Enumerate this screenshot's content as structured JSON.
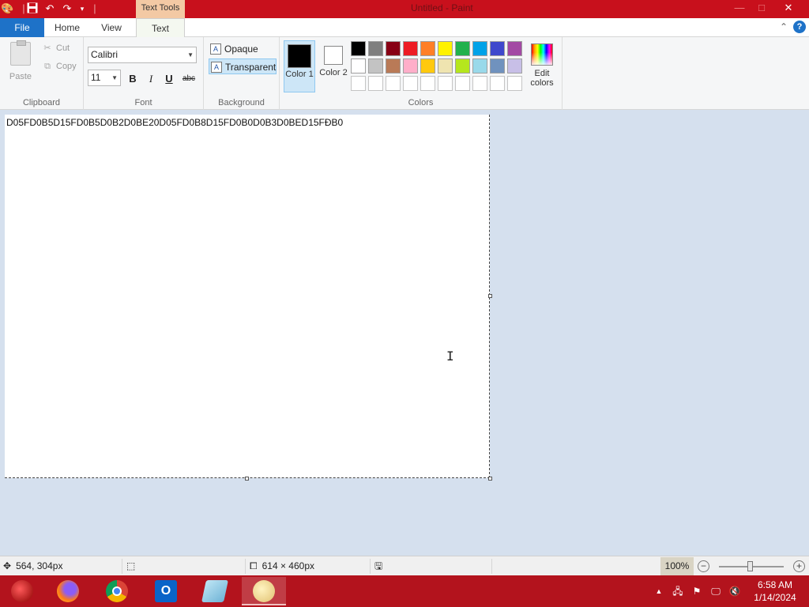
{
  "titlebar": {
    "contextual_tab": "Text Tools",
    "window_title": "Untitled - Paint",
    "minimize": "—",
    "maximize": "□",
    "close": "✕"
  },
  "tabs": {
    "file": "File",
    "home": "Home",
    "view": "View",
    "text": "Text"
  },
  "clipboard": {
    "group_label": "Clipboard",
    "paste": "Paste",
    "cut": "Cut",
    "copy": "Copy"
  },
  "font": {
    "group_label": "Font",
    "family": "Calibri",
    "size": "11",
    "bold": "B",
    "italic": "I",
    "underline": "U",
    "strikethrough": "abc"
  },
  "background": {
    "group_label": "Background",
    "opaque": "Opaque",
    "transparent": "Transparent"
  },
  "colors": {
    "group_label": "Colors",
    "color1_label": "Color 1",
    "color2_label": "Color 2",
    "color1_value": "#000000",
    "color2_value": "#ffffff",
    "edit_colors": "Edit colors",
    "palette_row1": [
      "#000000",
      "#7f7f7f",
      "#880015",
      "#ed1c24",
      "#ff7f27",
      "#fff200",
      "#22b14c",
      "#00a2e8",
      "#3f48cc",
      "#a349a4"
    ],
    "palette_row2": [
      "#ffffff",
      "#c3c3c3",
      "#b97a57",
      "#ffaec9",
      "#ffc90e",
      "#efe4b0",
      "#b5e61d",
      "#99d9ea",
      "#7092be",
      "#c8bfe7"
    ],
    "palette_row3": [
      "#ffffff",
      "#ffffff",
      "#ffffff",
      "#ffffff",
      "#ffffff",
      "#ffffff",
      "#ffffff",
      "#ffffff",
      "#ffffff",
      "#ffffff"
    ]
  },
  "canvas": {
    "text": "D05FD0B5D15FD0B5D0B2D0BE20D05FD0B8D15FD0B0D0B3D0BED15FĐB0"
  },
  "status": {
    "cursor_pos": "564, 304px",
    "canvas_size": "614 × 460px",
    "zoom": "100%"
  },
  "taskbar": {
    "time": "6:58 AM",
    "date": "1/14/2024"
  }
}
